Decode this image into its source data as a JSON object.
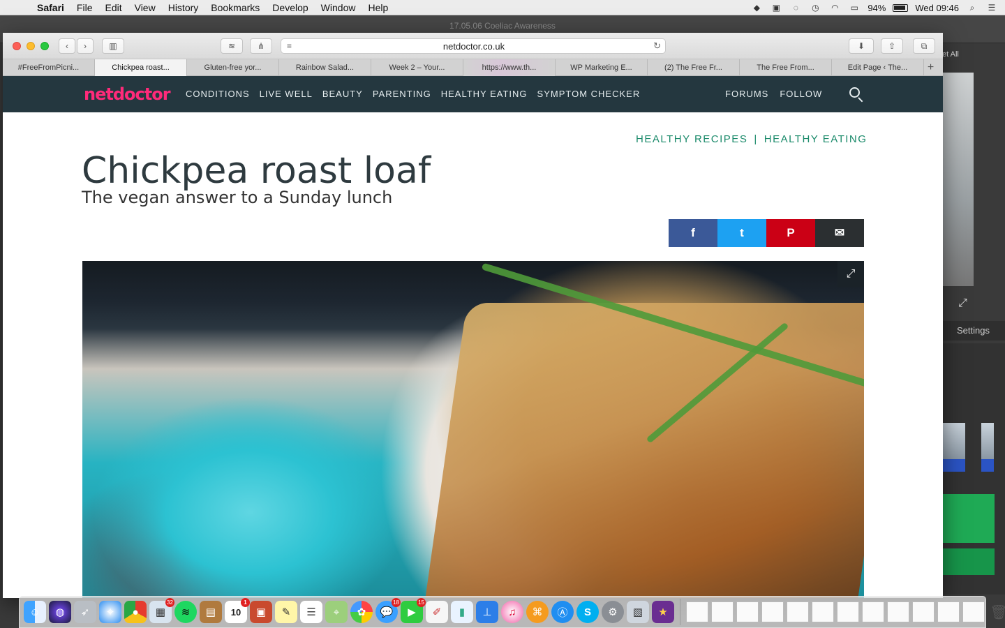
{
  "menubar": {
    "apple": "",
    "app_name": "Safari",
    "items": [
      "File",
      "Edit",
      "View",
      "History",
      "Bookmarks",
      "Develop",
      "Window",
      "Help"
    ],
    "battery": "94%",
    "clock": "Wed 09:46"
  },
  "background_app": {
    "title": "17.05.06 Coeliac Awareness",
    "see_all": "et All",
    "settings": "Settings"
  },
  "browser": {
    "url": "netdoctor.co.uk",
    "tabs": [
      {
        "label": "#FreeFromPicni..."
      },
      {
        "label": "Chickpea roast..."
      },
      {
        "label": "Gluten-free yor..."
      },
      {
        "label": "Rainbow Salad..."
      },
      {
        "label": "Week 2 – Your..."
      },
      {
        "label": "https://www.th..."
      },
      {
        "label": "WP Marketing E..."
      },
      {
        "label": "(2) The Free Fr..."
      },
      {
        "label": "The Free From..."
      },
      {
        "label": "Edit Page ‹ The..."
      }
    ],
    "new_tab": "+"
  },
  "site": {
    "logo": "netdoctor",
    "nav": [
      "CONDITIONS",
      "LIVE WELL",
      "BEAUTY",
      "PARENTING",
      "HEALTHY EATING",
      "SYMPTOM CHECKER"
    ],
    "nav_right": [
      "FORUMS",
      "FOLLOW"
    ],
    "breadcrumb": [
      "HEALTHY RECIPES",
      "HEALTHY EATING"
    ],
    "breadcrumb_sep": "|",
    "title": "Chickpea roast loaf",
    "subtitle": "The vegan answer to a Sunday lunch",
    "share": {
      "facebook": "f",
      "twitter": "t",
      "pinterest": "P",
      "email": "✉"
    },
    "expand_icon": "⤢"
  },
  "dock": {
    "calendar_day": "10",
    "badges": {
      "photos": "32",
      "messages": "18",
      "facetime": "15",
      "calendar": "1"
    }
  }
}
